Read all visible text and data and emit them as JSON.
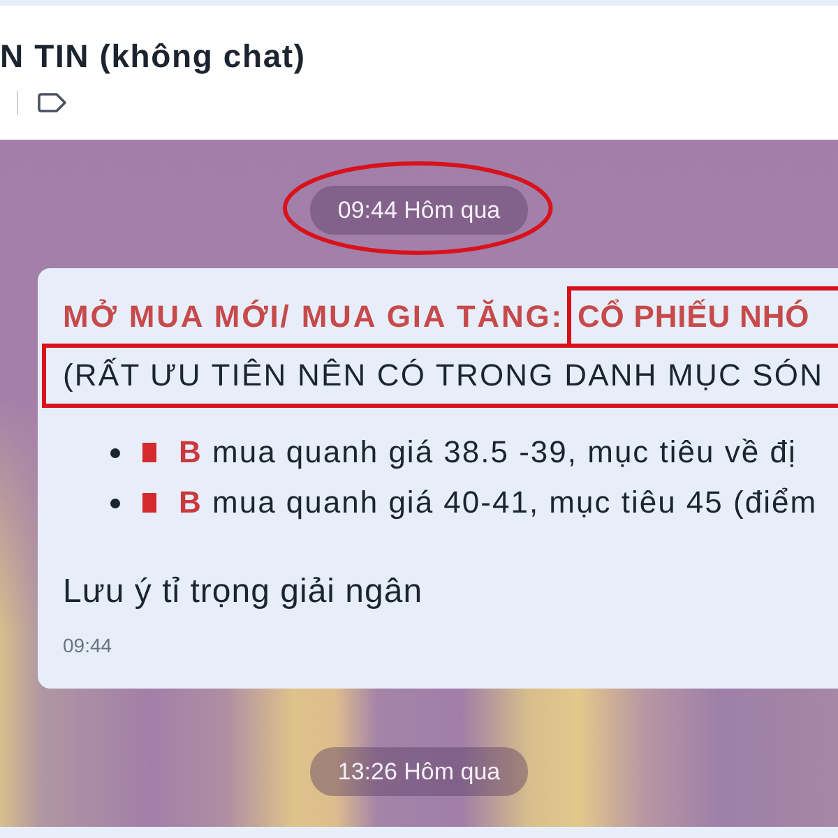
{
  "header": {
    "title": "N TIN (không chat)"
  },
  "timeline": [
    {
      "kind": "date",
      "label": "09:44 Hôm qua",
      "circled": true
    },
    {
      "kind": "message",
      "heading": [
        {
          "text": "MỞ MUA MỚI/ MUA GIA TĂNG:",
          "boxed": false
        },
        {
          "text": "CỔ PHIẾU NHÓ",
          "boxed": true
        }
      ],
      "subheading": {
        "text": "(RẤT ƯU TIÊN NÊN CÓ TRONG DANH MỤC SÓN",
        "boxed": true
      },
      "items": [
        {
          "redacted": true,
          "text": "**B** mua quanh giá 38.5 -39, mục tiêu về đị"
        },
        {
          "redacted": true,
          "text": "**B** mua quanh giá 40-41, mục tiêu 45 (điểm"
        }
      ],
      "note": "Lưu ý tỉ trọng giải ngân",
      "time": "09:44"
    },
    {
      "kind": "date",
      "label": "13:26 Hôm qua",
      "circled": false
    }
  ]
}
